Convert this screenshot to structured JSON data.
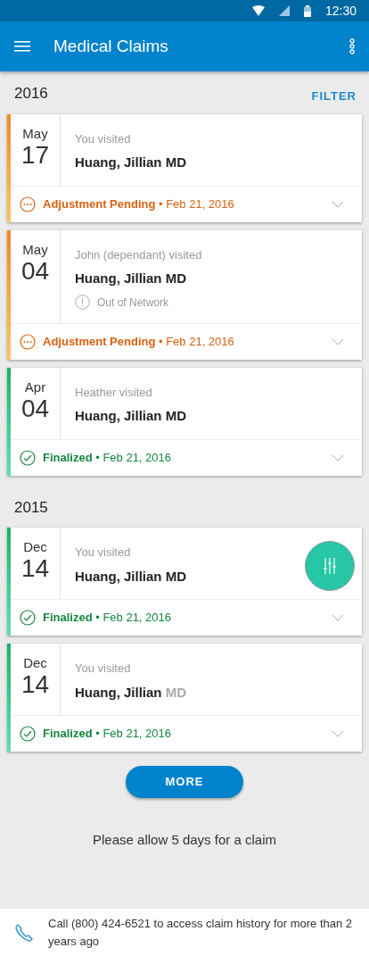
{
  "status_bar": {
    "time": "12:30"
  },
  "app_bar": {
    "title": "Medical Claims"
  },
  "filter_label": "FILTER",
  "groups": [
    {
      "year": "2016",
      "claims": [
        {
          "month": "May",
          "day": "17",
          "visitor": "You visited",
          "provider": "Huang, Jillian",
          "credential": "MD",
          "credential_muted": false,
          "kind": "pending",
          "status_label": "Adjustment Pending",
          "status_date": "• Feb 21, 2016"
        },
        {
          "month": "May",
          "day": "04",
          "visitor": "John (dependant) visited",
          "provider": "Huang, Jillian",
          "credential": "MD",
          "credential_muted": false,
          "note": "Out of Network",
          "kind": "pending",
          "status_label": "Adjustment Pending",
          "status_date": "• Feb 21, 2016"
        },
        {
          "month": "Apr",
          "day": "04",
          "visitor": "Heather visited",
          "provider": "Huang, Jillian",
          "credential": "MD",
          "credential_muted": false,
          "kind": "finalized",
          "status_label": "Finalized",
          "status_date": "• Feb 21, 2016"
        }
      ]
    },
    {
      "year": "2015",
      "claims": [
        {
          "month": "Dec",
          "day": "14",
          "visitor": "You visited",
          "provider": "Huang, Jillian",
          "credential": "MD",
          "credential_muted": false,
          "kind": "finalized",
          "status_label": "Finalized",
          "status_date": "• Feb 21, 2016",
          "fab": true
        },
        {
          "month": "Dec",
          "day": "14",
          "visitor": "You visited",
          "provider": "Huang, Jillian",
          "credential": "MD",
          "credential_muted": true,
          "kind": "finalized",
          "status_label": "Finalized",
          "status_date": "• Feb 21, 2016"
        }
      ]
    }
  ],
  "more_button": "MORE",
  "notice": "Please allow 5 days for a claim",
  "footer": {
    "text": "Call (800) 424-6521 to access claim history for more than 2 years ago"
  }
}
